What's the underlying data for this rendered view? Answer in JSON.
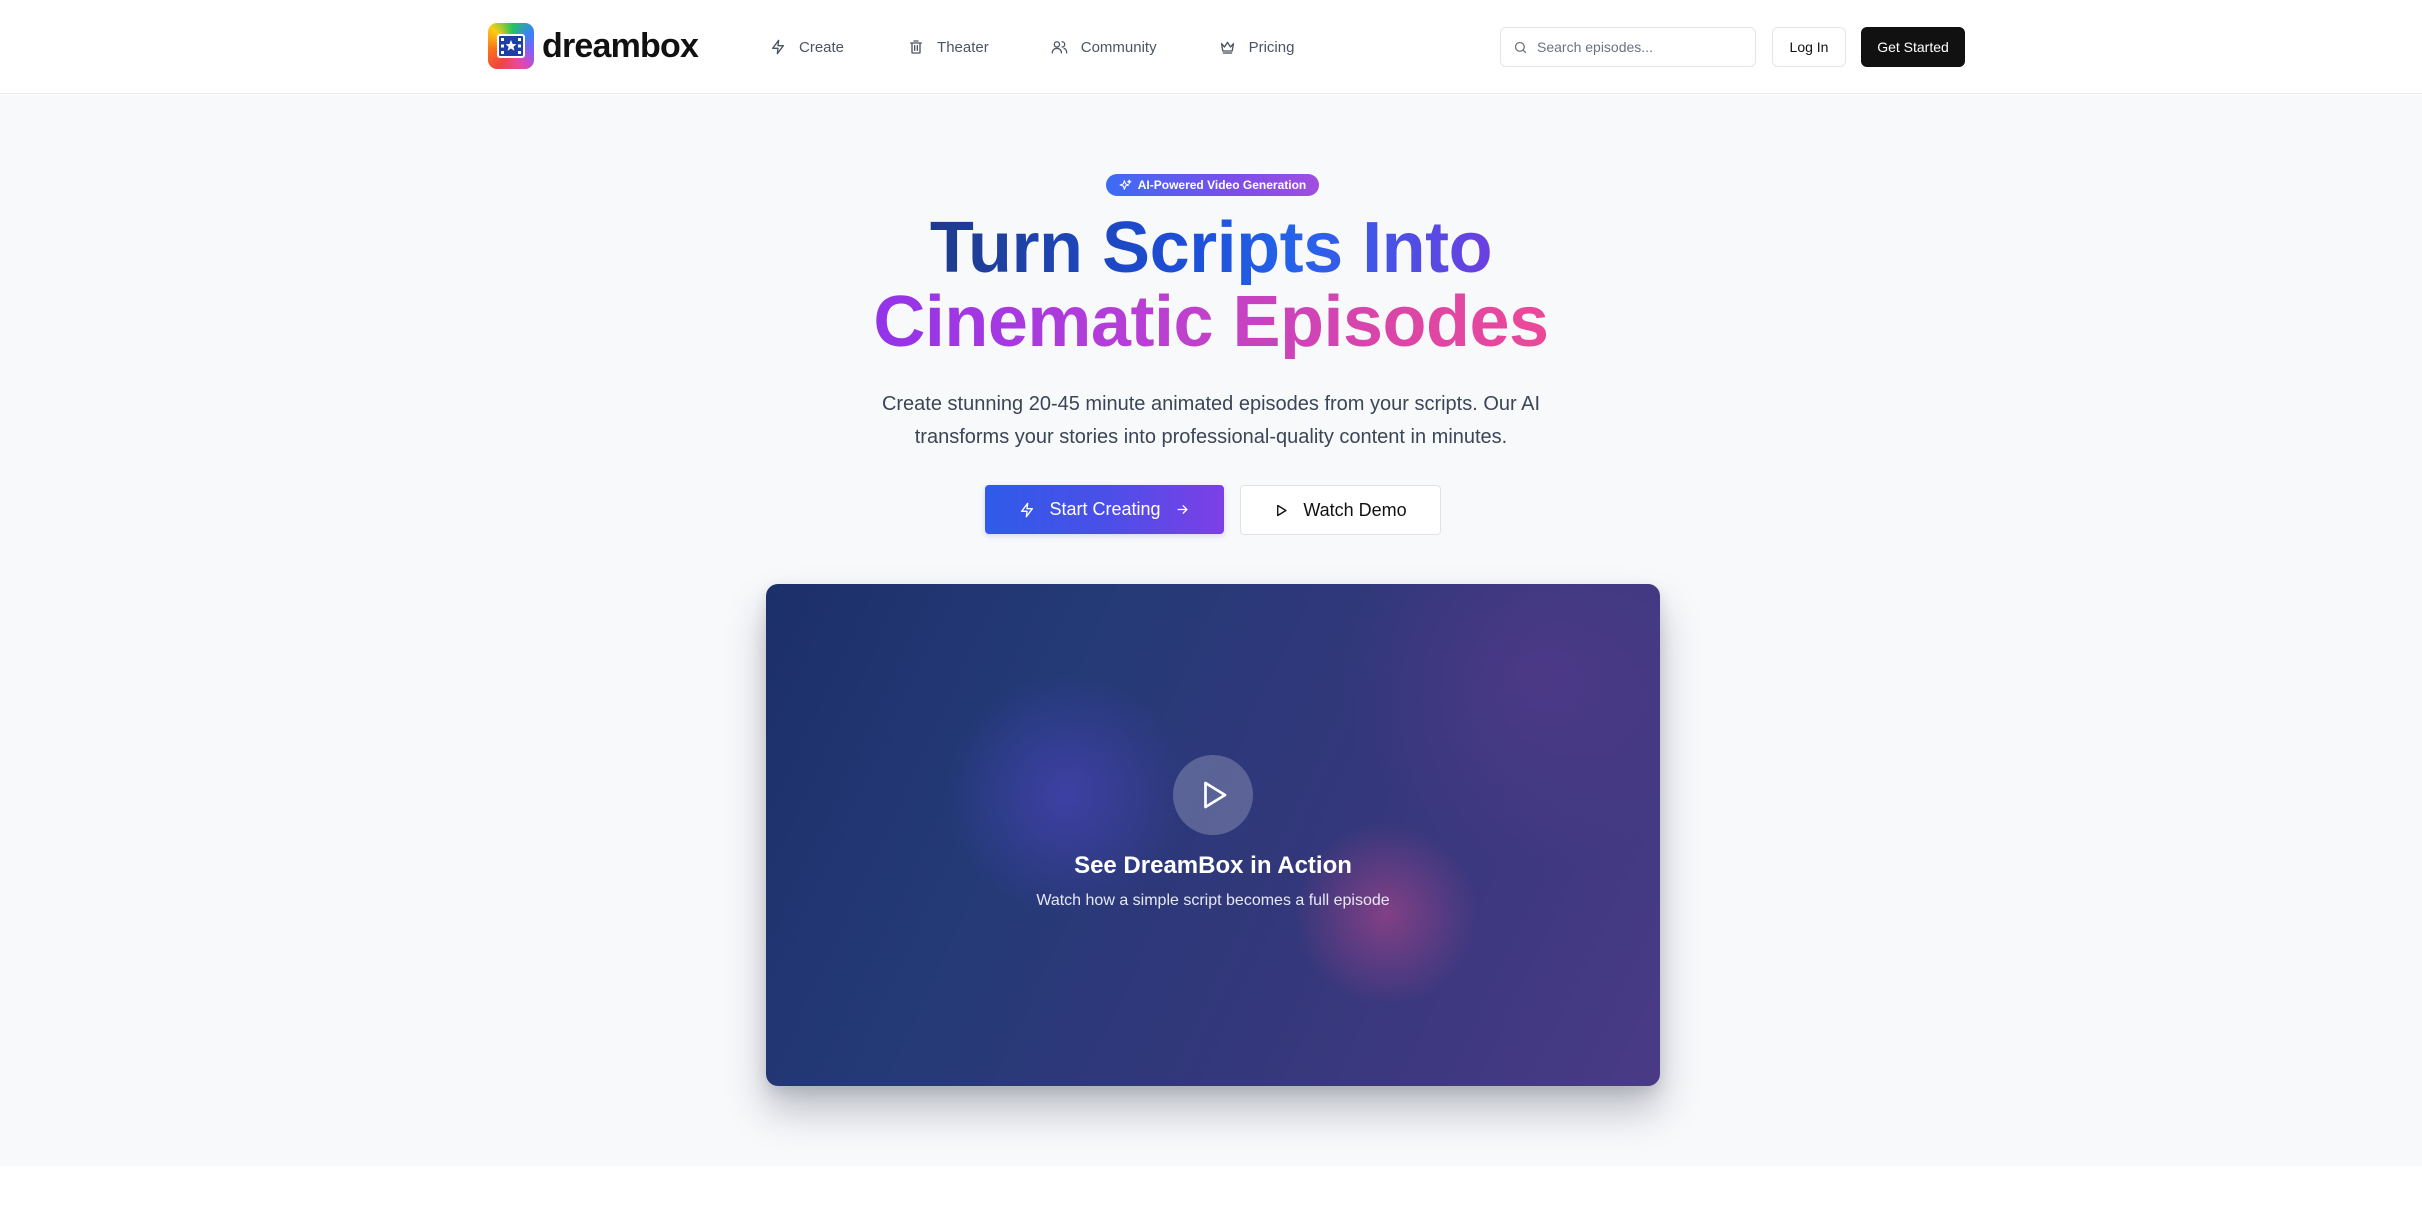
{
  "brand": {
    "name": "dreambox"
  },
  "nav": {
    "items": [
      {
        "label": "Create",
        "icon": "lightning-icon"
      },
      {
        "label": "Theater",
        "icon": "trash-can-icon"
      },
      {
        "label": "Community",
        "icon": "users-icon"
      },
      {
        "label": "Pricing",
        "icon": "crown-icon"
      }
    ],
    "search": {
      "placeholder": "Search episodes...",
      "value": ""
    },
    "login_label": "Log In",
    "get_started_label": "Get Started"
  },
  "hero": {
    "badge": "AI-Powered Video Generation",
    "headline_line1": "Turn Scripts Into",
    "headline_line2": "Cinematic Episodes",
    "subtitle_line1": "Create stunning 20-45 minute animated episodes from your scripts. Our AI",
    "subtitle_line2": "transforms your stories into professional-quality content in minutes.",
    "primary_cta": "Start Creating",
    "secondary_cta": "Watch Demo"
  },
  "video": {
    "title": "See DreamBox in Action",
    "subtitle": "Watch how a simple script becomes a full episode"
  },
  "colors": {
    "primary_button": "#111111",
    "cta_gradient_start": "#2f5be8",
    "cta_gradient_end": "#7d3fe6",
    "headline_blue": "#1e3a8a",
    "headline_pink": "#ec4899",
    "video_bg": "#243a77"
  }
}
